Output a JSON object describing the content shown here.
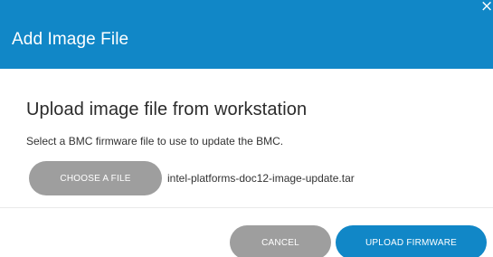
{
  "dialog": {
    "title": "Add Image File",
    "close_glyph": "×",
    "close_icon": "close-icon"
  },
  "body": {
    "heading": "Upload image file from workstation",
    "description": "Select a BMC firmware file to use to update the BMC.",
    "choose_file_label": "CHOOSE A FILE",
    "selected_file_name": "intel-platforms-doc12-image-update.tar"
  },
  "footer": {
    "cancel_label": "CANCEL",
    "upload_label": "UPLOAD FIRMWARE"
  },
  "colors": {
    "header_bg": "#1187c7",
    "primary_button": "#1187c7",
    "secondary_button": "#9e9e9e"
  }
}
